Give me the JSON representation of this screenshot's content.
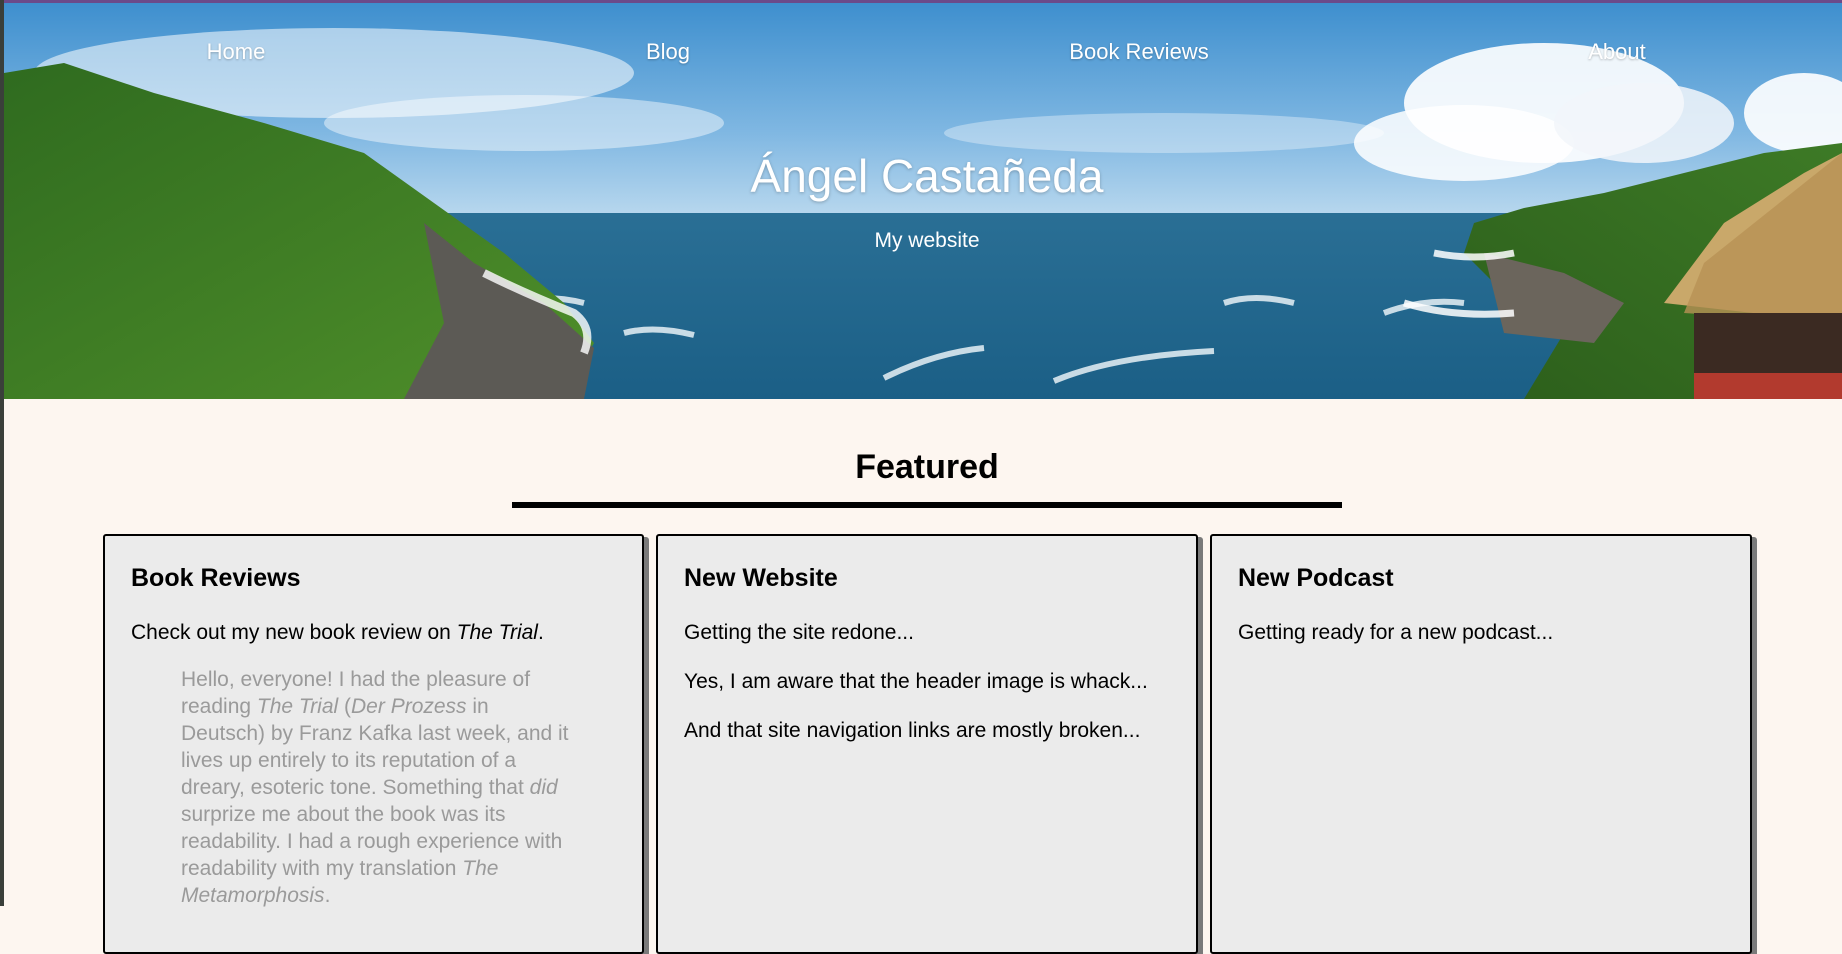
{
  "nav": {
    "home": "Home",
    "blog": "Blog",
    "book_reviews": "Book Reviews",
    "about": "About"
  },
  "header": {
    "title": "Ángel Castañeda",
    "subtitle": "My website"
  },
  "featured": {
    "heading": "Featured",
    "cards": [
      {
        "title": "Book Reviews",
        "intro_prefix": "Check out my new book review on ",
        "intro_book": "The Trial",
        "intro_suffix": ".",
        "quote": {
          "t1": "Hello, everyone! I had the pleasure of reading ",
          "i1": "The Trial",
          "t2": " (",
          "i2": "Der Prozess",
          "t3": " in Deutsch) by Franz Kafka last week, and it lives up entirely to its reputation of a dreary, esoteric tone. Something that ",
          "i3": "did",
          "t4": " surprize me about the book was its readability. I had a rough experience with readability with my translation ",
          "i4": "The Metamorphosis",
          "t5": "."
        }
      },
      {
        "title": "New Website",
        "paragraphs": [
          "Getting the site redone...",
          "Yes, I am aware that the header image is whack...",
          "And that site navigation links are mostly broken..."
        ]
      },
      {
        "title": "New Podcast",
        "paragraphs": [
          "Getting ready for a new podcast..."
        ]
      }
    ]
  },
  "colors": {
    "page_background": "#fdf6f0",
    "card_background": "#ebebeb",
    "quote_text": "#9a9a9a"
  }
}
